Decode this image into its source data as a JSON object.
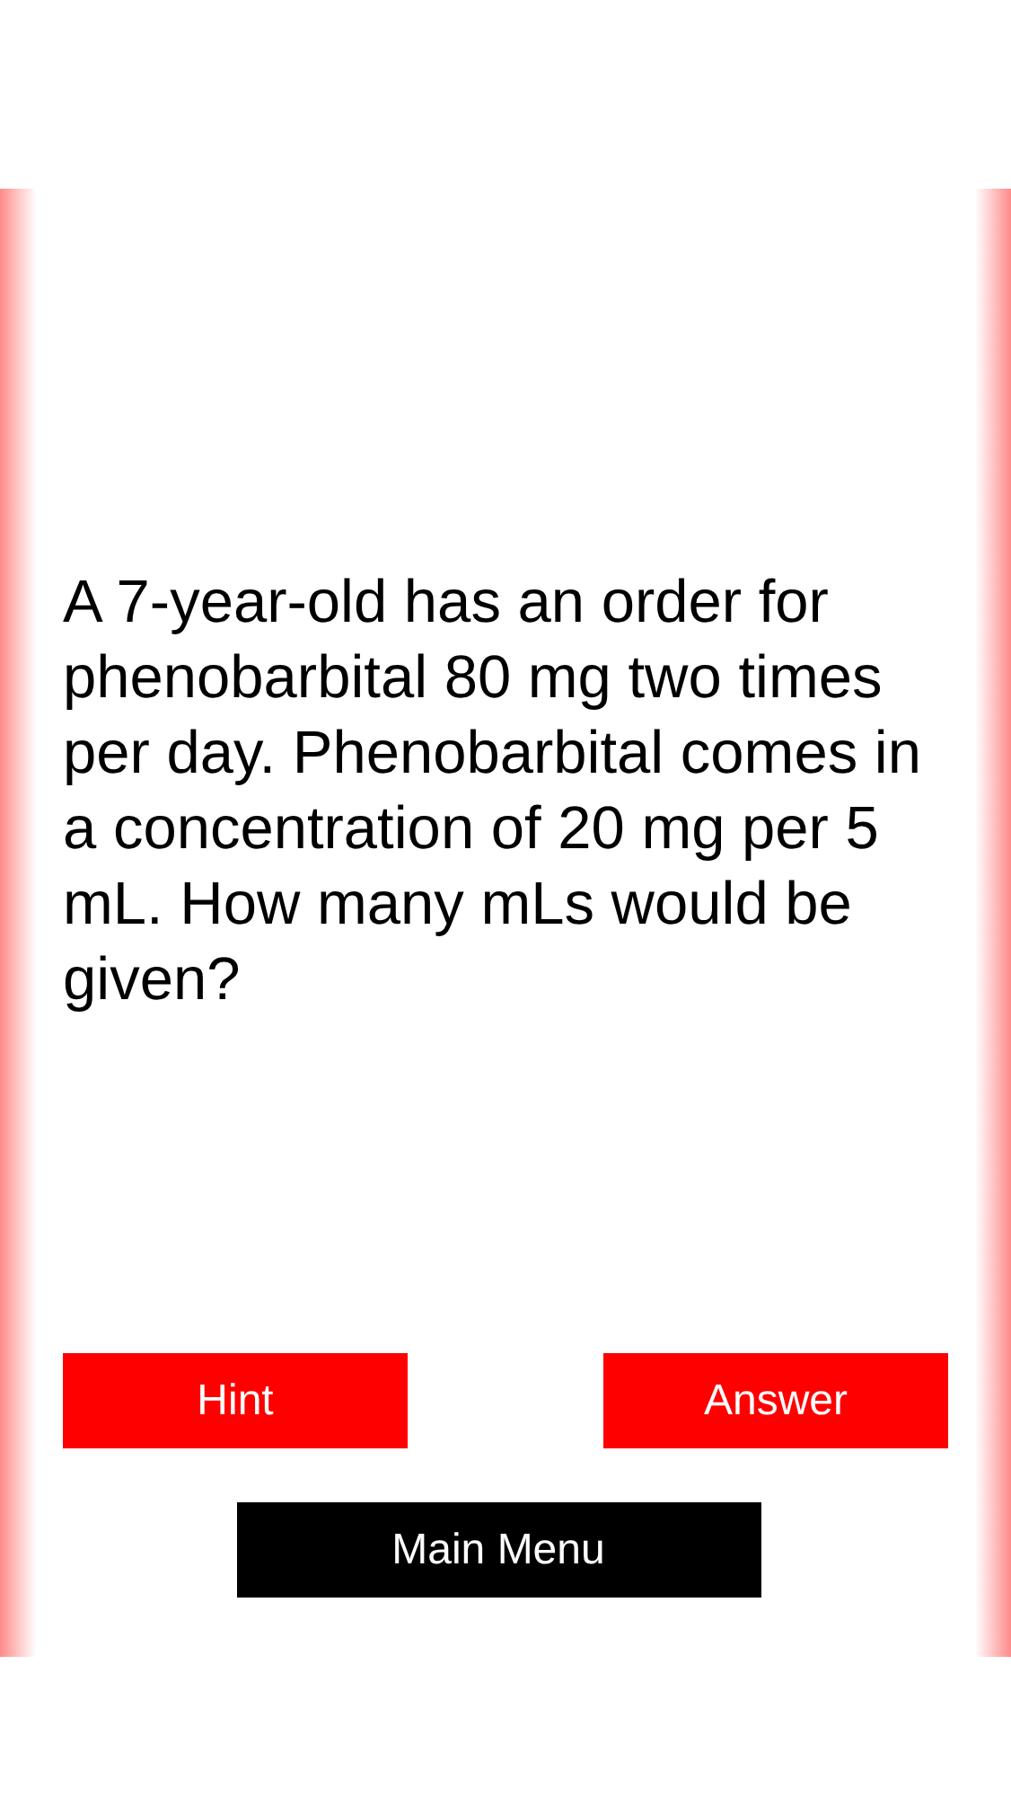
{
  "question": "A 7-year-old has an order for phenobarbital 80 mg two times per day. Phenobarbital comes in a concentration of 20 mg per 5 mL. How many mLs would be given?",
  "hint_button": {
    "label": "Hint"
  },
  "answer_button": {
    "label": "Answer"
  },
  "menu_button": {
    "label": "Main Menu"
  }
}
